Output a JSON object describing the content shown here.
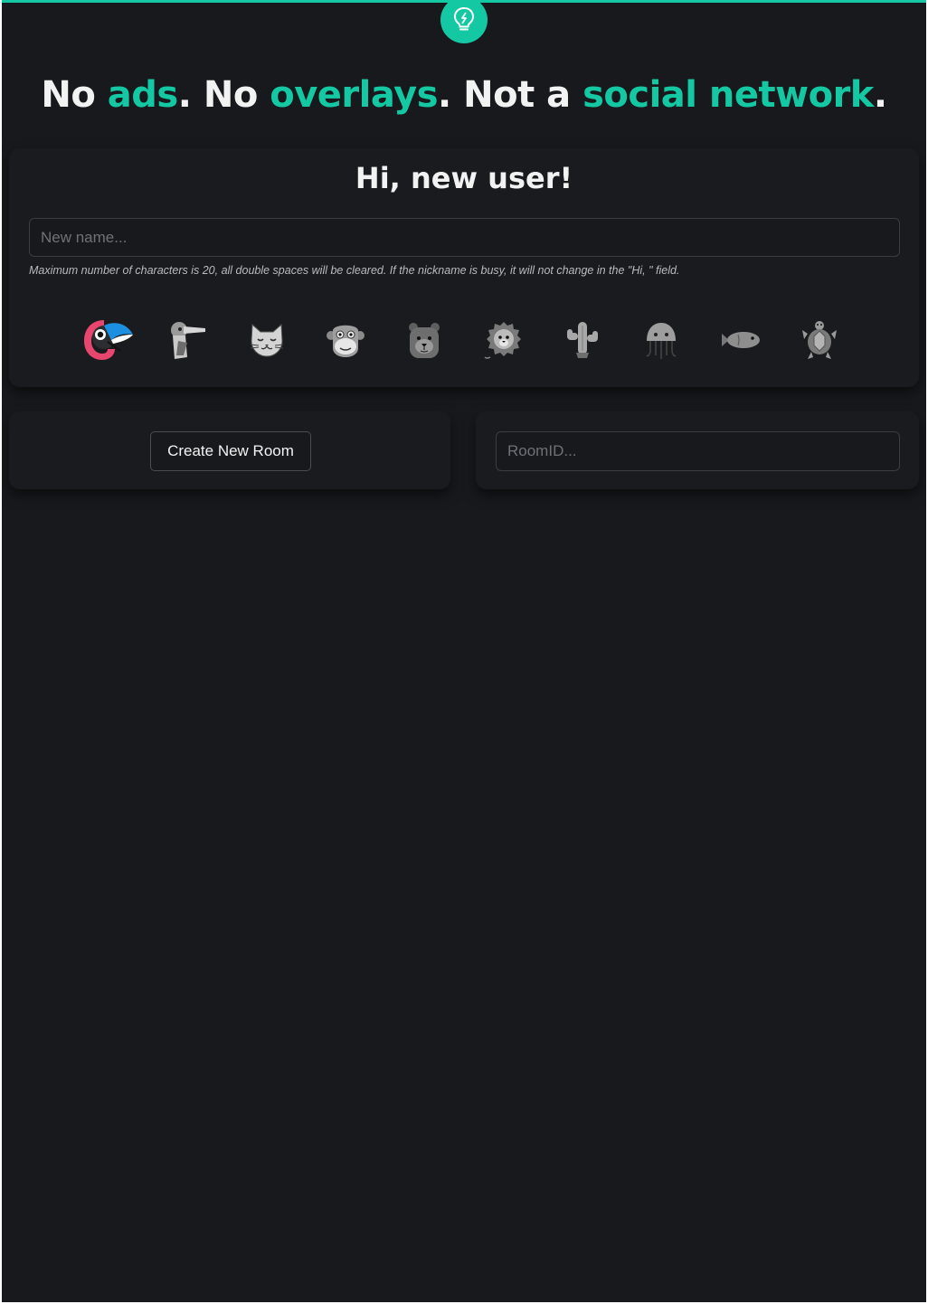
{
  "theme": {
    "accent": "#14c8a4",
    "background": "#17191c",
    "text": "#f2f2f2"
  },
  "logo": {
    "icon": "lightbulb-icon"
  },
  "headline": {
    "w1": "No ",
    "w2": "ads",
    "w3": ". No ",
    "w4": "overlays",
    "w5": ". Not a ",
    "w6": "social network",
    "w7": "."
  },
  "profile": {
    "greeting": "Hi, new user!",
    "name_placeholder": "New name...",
    "name_value": "",
    "hint": "Maximum number of characters is 20, all double spaces will be cleared. If the nickname is busy, it will not change in the \"Hi, \" field.",
    "avatars": [
      {
        "name": "toucan-icon",
        "selected": true
      },
      {
        "name": "pelican-icon",
        "selected": false
      },
      {
        "name": "cat-icon",
        "selected": false
      },
      {
        "name": "monkey-icon",
        "selected": false
      },
      {
        "name": "bear-icon",
        "selected": false
      },
      {
        "name": "lion-icon",
        "selected": false
      },
      {
        "name": "cactus-icon",
        "selected": false
      },
      {
        "name": "jellyfish-icon",
        "selected": false
      },
      {
        "name": "fish-icon",
        "selected": false
      },
      {
        "name": "turtle-icon",
        "selected": false
      }
    ]
  },
  "room": {
    "create_label": "Create New Room",
    "room_placeholder": "RoomID...",
    "room_value": ""
  }
}
